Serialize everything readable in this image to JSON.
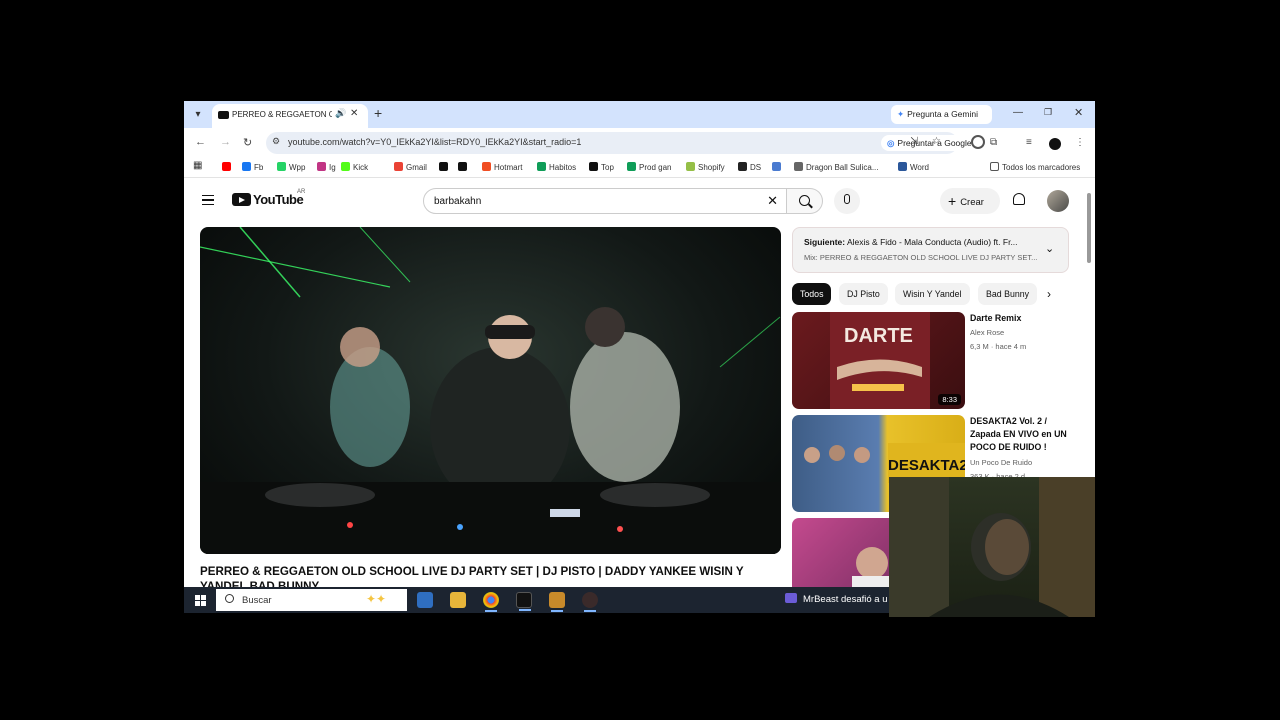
{
  "browser": {
    "tab_title": "PERREO & REGGAETON OL",
    "gemini_label": "Pregunta a Gemini",
    "url": "youtube.com/watch?v=Y0_IEkKa2YI&list=RDY0_IEkKa2YI&start_radio=1",
    "ask_google_label": "Preguntar a Google",
    "bookmarks": [
      {
        "label": "",
        "icon": "youtube-icon",
        "color": "#ff0000"
      },
      {
        "label": "Fb",
        "icon": "facebook-icon",
        "color": "#1877f2"
      },
      {
        "label": "Wpp",
        "icon": "whatsapp-icon",
        "color": "#25d366"
      },
      {
        "label": "Ig",
        "icon": "instagram-icon",
        "color": "#c13584"
      },
      {
        "label": "Kick",
        "icon": "kick-icon",
        "color": "#53fc18"
      },
      {
        "label": "Gmail",
        "icon": "gmail-icon",
        "color": "#ea4335"
      },
      {
        "label": "",
        "icon": "notion-icon",
        "color": "#111111"
      },
      {
        "label": "",
        "icon": "tiktok-icon",
        "color": "#111111"
      },
      {
        "label": "Hotmart",
        "icon": "hotmart-icon",
        "color": "#f04e23"
      },
      {
        "label": "Habitos",
        "icon": "sheets-icon",
        "color": "#0f9d58"
      },
      {
        "label": "Top",
        "icon": "tiktok-icon",
        "color": "#111111"
      },
      {
        "label": "Prod gan",
        "icon": "sheets-icon",
        "color": "#0f9d58"
      },
      {
        "label": "Shopify",
        "icon": "shopify-icon",
        "color": "#95bf47"
      },
      {
        "label": "DS",
        "icon": "ds-icon",
        "color": "#222222"
      },
      {
        "label": "",
        "icon": "circle-icon",
        "color": "#4a7bd0"
      },
      {
        "label": "Dragon Ball Sulica...",
        "icon": "globe-icon",
        "color": "#666666"
      },
      {
        "label": "Word",
        "icon": "word-icon",
        "color": "#2b579a"
      }
    ],
    "all_bookmarks_label": "Todos los marcadores"
  },
  "youtube": {
    "wordmark": "YouTube",
    "region": "AR",
    "search_query": "barbakahn",
    "create_label": "Crear",
    "video_title": "PERREO & REGGAETON OLD SCHOOL LIVE DJ PARTY SET | DJ PISTO | DADDY YANKEE WISIN Y YANDEL BAD BUNNY",
    "next": {
      "prefix": "Siguiente:",
      "title": "Alexis & Fido - Mala Conducta (Audio) ft. Fr...",
      "mix": "Mix: PERREO & REGGAETON OLD SCHOOL LIVE DJ PARTY SET..."
    },
    "chips": [
      "Todos",
      "DJ Pisto",
      "Wisin Y Yandel",
      "Bad Bunny"
    ],
    "recommendations": [
      {
        "title": "Darte Remix",
        "channel": "Alex Rose",
        "meta": "6,3 M · hace 4 m",
        "duration": "8:33"
      },
      {
        "title": "DESAKTA2 Vol. 2 / Zapada EN VIVO en UN POCO DE RUIDO !",
        "channel": "Un Poco De Ruido",
        "meta": "363 K · hace 2 d",
        "duration": ""
      },
      {
        "title": "",
        "channel": "",
        "meta": "",
        "duration": ""
      }
    ]
  },
  "taskbar": {
    "search_label": "Buscar",
    "news": "MrBeast desafió a u"
  }
}
